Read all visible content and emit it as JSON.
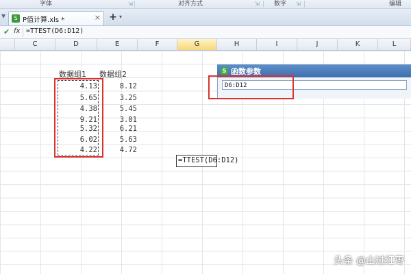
{
  "ribbon": {
    "groups": [
      "字体",
      "对齐方式",
      "数字",
      "编辑"
    ]
  },
  "tabs": [
    {
      "label": "P值计算.xls *",
      "close": "×"
    }
  ],
  "tabbar": {
    "add_label": "+",
    "dropdown": "▾"
  },
  "formula_bar": {
    "confirm_icon": "✔",
    "fx_label": "fx",
    "formula": "=TTEST(D6:D12)"
  },
  "columns": [
    "C",
    "D",
    "E",
    "F",
    "G",
    "H",
    "I",
    "J",
    "K",
    "L"
  ],
  "active_column": "G",
  "sheet": {
    "header_d": "数据组1",
    "header_e": "数据组2",
    "group1": [
      "4.13",
      "5.65",
      "4.38",
      "9.21",
      "5.32",
      "6.02",
      "4.22"
    ],
    "group2": [
      "8.12",
      "3.25",
      "5.45",
      "3.01",
      "6.21",
      "5.63",
      "4.72"
    ],
    "editing_cell": "=TTEST(D6:D12)"
  },
  "dialog": {
    "title": "函数参数",
    "range_value": "D6:D12"
  },
  "watermark": "头条 @山过红枣",
  "colors": {
    "highlight_red": "#d9322f",
    "dialog_title": "#3e6fb0",
    "active_column": "#f7d77a"
  }
}
